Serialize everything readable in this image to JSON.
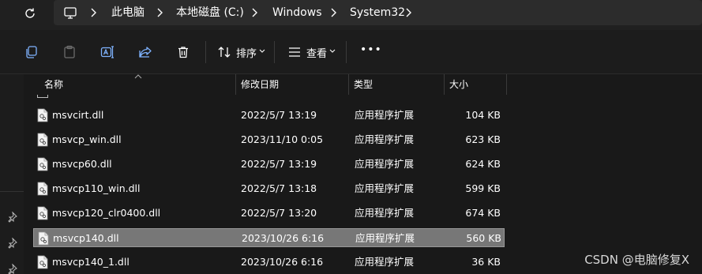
{
  "address": {
    "crumbs": [
      "此电脑",
      "本地磁盘 (C:)",
      "Windows",
      "System32"
    ]
  },
  "toolbar": {
    "sort_label": "排序",
    "view_label": "查看",
    "more_label": "•••"
  },
  "columns": {
    "name": "名称",
    "modified": "修改日期",
    "type": "类型",
    "size": "大小"
  },
  "files": [
    {
      "name": "msvcirt.dll",
      "modified": "2022/5/7 13:19",
      "type": "应用程序扩展",
      "size": "104 KB"
    },
    {
      "name": "msvcp_win.dll",
      "modified": "2023/11/10 0:05",
      "type": "应用程序扩展",
      "size": "623 KB"
    },
    {
      "name": "msvcp60.dll",
      "modified": "2022/5/7 13:19",
      "type": "应用程序扩展",
      "size": "624 KB"
    },
    {
      "name": "msvcp110_win.dll",
      "modified": "2022/5/7 13:18",
      "type": "应用程序扩展",
      "size": "599 KB"
    },
    {
      "name": "msvcp120_clr0400.dll",
      "modified": "2022/5/7 13:20",
      "type": "应用程序扩展",
      "size": "674 KB"
    },
    {
      "name": "msvcp140.dll",
      "modified": "2023/10/26 6:16",
      "type": "应用程序扩展",
      "size": "560 KB",
      "selected": true
    },
    {
      "name": "msvcp140_1.dll",
      "modified": "2023/10/26 6:16",
      "type": "应用程序扩展",
      "size": "36 KB"
    }
  ],
  "watermark": "CSDN @电脑修复X"
}
